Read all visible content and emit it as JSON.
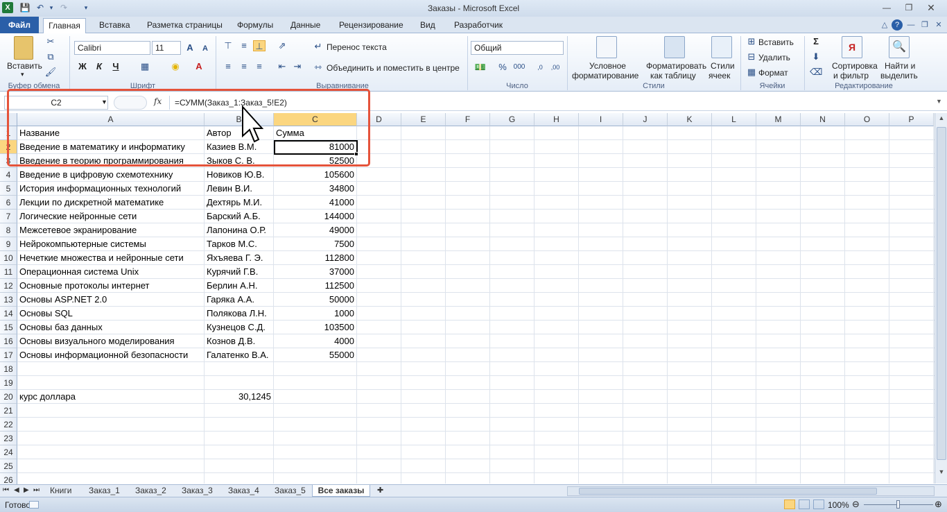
{
  "window": {
    "title": "Заказы - Microsoft Excel"
  },
  "tabs": [
    "Файл",
    "Главная",
    "Вставка",
    "Разметка страницы",
    "Формулы",
    "Данные",
    "Рецензирование",
    "Вид",
    "Разработчик"
  ],
  "ribbon": {
    "paste": "Вставить",
    "font_name": "Calibri",
    "font_size": "11",
    "wrap_text": "Перенос текста",
    "merge_center": "Объединить и поместить в центре",
    "number_format": "Общий",
    "conditional_fmt_1": "Условное",
    "conditional_fmt_2": "форматирование",
    "format_table_1": "Форматировать",
    "format_table_2": "как таблицу",
    "cell_styles_1": "Стили",
    "cell_styles_2": "ячеек",
    "insert": "Вставить",
    "delete": "Удалить",
    "format": "Формат",
    "sort_1": "Сортировка",
    "sort_2": "и фильтр",
    "find_1": "Найти и",
    "find_2": "выделить",
    "groups": {
      "clipboard": "Буфер обмена",
      "font": "Шрифт",
      "alignment": "Выравнивание",
      "number": "Число",
      "styles": "Стили",
      "cells": "Ячейки",
      "editing": "Редактирование"
    }
  },
  "formula_bar": {
    "name_box": "C2",
    "fx": "fx",
    "formula": "=СУММ(Заказ_1:Заказ_5!E2)"
  },
  "columns": [
    "A",
    "B",
    "C",
    "D",
    "E",
    "F",
    "G",
    "H",
    "I",
    "J",
    "K",
    "L",
    "M",
    "N",
    "O",
    "P"
  ],
  "rows": [
    {
      "n": "1",
      "a": "Название",
      "b": "Автор",
      "c": "Сумма"
    },
    {
      "n": "2",
      "a": "Введение в математику и информатику",
      "b": "Казиев В.М.",
      "c": "81000"
    },
    {
      "n": "3",
      "a": "Введение в теорию программирования",
      "b": "Зыков С. В.",
      "c": "52500"
    },
    {
      "n": "4",
      "a": "Введение в цифровую схемотехнику",
      "b": "Новиков Ю.В.",
      "c": "105600"
    },
    {
      "n": "5",
      "a": "История информационных технологий",
      "b": "Левин В.И.",
      "c": "34800"
    },
    {
      "n": "6",
      "a": "Лекции по дискретной математике",
      "b": "Дехтярь М.И.",
      "c": "41000"
    },
    {
      "n": "7",
      "a": "Логические нейронные сети",
      "b": "Барский А.Б.",
      "c": "144000"
    },
    {
      "n": "8",
      "a": "Межсетевое экранирование",
      "b": "Лапонина О.Р.",
      "c": "49000"
    },
    {
      "n": "9",
      "a": "Нейрокомпьютерные системы",
      "b": "Тарков М.С.",
      "c": "7500"
    },
    {
      "n": "10",
      "a": "Нечеткие множества и нейронные сети",
      "b": "Яхъяева Г. Э.",
      "c": "112800"
    },
    {
      "n": "11",
      "a": "Операционная система Unix",
      "b": "Курячий Г.В.",
      "c": "37000"
    },
    {
      "n": "12",
      "a": "Основные протоколы интернет",
      "b": "Берлин А.Н.",
      "c": "112500"
    },
    {
      "n": "13",
      "a": "Основы ASP.NET 2.0",
      "b": "Гаряка А.А.",
      "c": "50000"
    },
    {
      "n": "14",
      "a": "Основы SQL",
      "b": "Полякова Л.Н.",
      "c": "1000"
    },
    {
      "n": "15",
      "a": "Основы баз данных",
      "b": "Кузнецов С.Д.",
      "c": "103500"
    },
    {
      "n": "16",
      "a": "Основы визуального моделирования",
      "b": "Кознов Д.В.",
      "c": "4000"
    },
    {
      "n": "17",
      "a": "Основы информационной безопасности",
      "b": "Галатенко В.А.",
      "c": "55000"
    },
    {
      "n": "18",
      "a": "",
      "b": "",
      "c": ""
    },
    {
      "n": "19",
      "a": "",
      "b": "",
      "c": ""
    },
    {
      "n": "20",
      "a": "курс доллара",
      "b": "30,1245",
      "c": ""
    },
    {
      "n": "21",
      "a": "",
      "b": "",
      "c": ""
    },
    {
      "n": "22",
      "a": "",
      "b": "",
      "c": ""
    },
    {
      "n": "23",
      "a": "",
      "b": "",
      "c": ""
    },
    {
      "n": "24",
      "a": "",
      "b": "",
      "c": ""
    },
    {
      "n": "25",
      "a": "",
      "b": "",
      "c": ""
    },
    {
      "n": "26",
      "a": "",
      "b": "",
      "c": ""
    }
  ],
  "selected_cell": "C2",
  "sheets": [
    "Книги",
    "Заказ_1",
    "Заказ_2",
    "Заказ_3",
    "Заказ_4",
    "Заказ_5",
    "Все заказы"
  ],
  "active_sheet": "Все заказы",
  "status": {
    "ready": "Готово",
    "zoom": "100%"
  },
  "colors": {
    "accent": "#2a5fa8",
    "highlight": "#fbd680",
    "annotation": "#e5533b"
  }
}
